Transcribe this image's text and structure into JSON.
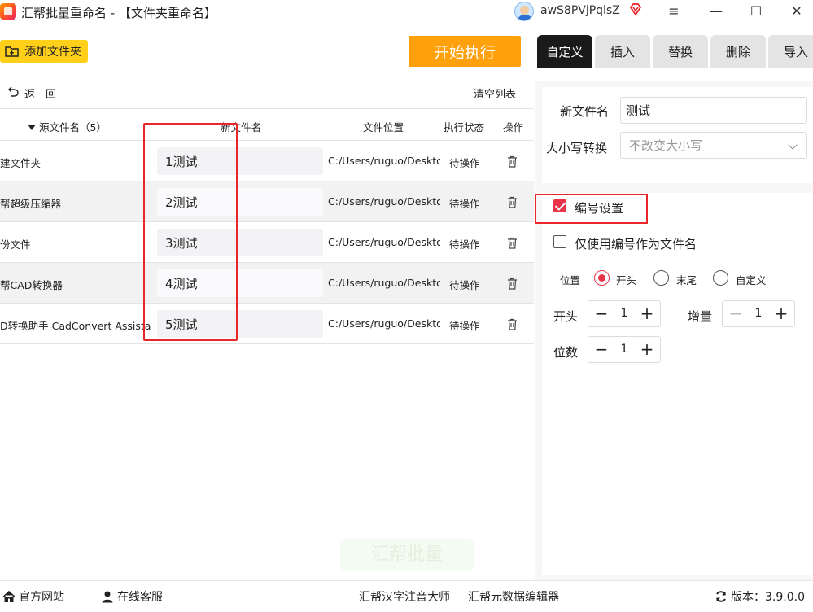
{
  "titlebar": {
    "title": "汇帮批量重命名 - 【文件夹重命名】",
    "username": "awS8PVjPqlsZ",
    "minimize": "—",
    "maximize": "☐",
    "close": "✕",
    "menu": "≡"
  },
  "toolbar": {
    "add_folder_label": "添加文件夹",
    "start_label": "开始执行"
  },
  "tabs": [
    {
      "label": "自定义",
      "active": true
    },
    {
      "label": "插入",
      "active": false
    },
    {
      "label": "替换",
      "active": false
    },
    {
      "label": "删除",
      "active": false
    },
    {
      "label": "导入",
      "active": false
    }
  ],
  "list": {
    "undo_label": "返　回",
    "clear_label": "清空列表",
    "headers": {
      "source": "源文件名（5）",
      "new_name": "新文件名",
      "location": "文件位置",
      "status": "执行状态",
      "ops": "操作"
    },
    "rows": [
      {
        "source": "建文件夹",
        "new_name": "1测试",
        "location": "C:/Users/ruguo/Deskto",
        "status": "待操作"
      },
      {
        "source": "帮超级压缩器",
        "new_name": "2测试",
        "location": "C:/Users/ruguo/Deskto",
        "status": "待操作"
      },
      {
        "source": "份文件",
        "new_name": "3测试",
        "location": "C:/Users/ruguo/Deskto",
        "status": "待操作"
      },
      {
        "source": "帮CAD转换器",
        "new_name": "4测试",
        "location": "C:/Users/ruguo/Deskto",
        "status": "待操作"
      },
      {
        "source": "D转换助手 CadConvert Assistant",
        "new_name": "5测试",
        "location": "C:/Users/ruguo/Deskto",
        "status": "待操作"
      }
    ]
  },
  "panel": {
    "new_name_label": "新文件名",
    "new_name_value": "测试",
    "case_label": "大小写转换",
    "case_value": "不改变大小写",
    "numbering_label": "编号设置",
    "numbering_checked": true,
    "only_number_label": "仅使用编号作为文件名",
    "only_number_checked": false,
    "position_label": "位置",
    "positions": [
      {
        "label": "开头",
        "checked": true
      },
      {
        "label": "末尾",
        "checked": false
      },
      {
        "label": "自定义",
        "checked": false
      }
    ],
    "start_label": "开头",
    "start_value": "1",
    "increment_label": "增量",
    "increment_value": "1",
    "digits_label": "位数",
    "digits_value": "1",
    "minus": "−",
    "plus": "+"
  },
  "watermark": "汇帮批量",
  "footer": {
    "website": "官方网站",
    "support": "在线客服",
    "link1": "汇帮汉字注音大师",
    "link2": "汇帮元数据编辑器",
    "version": "版本：3.9.0.0"
  },
  "colors": {
    "accent_orange": "#ffa10d",
    "add_yellow": "#ffcf1a",
    "checked_red": "#e8334a",
    "highlight_box": "#e8262b"
  }
}
